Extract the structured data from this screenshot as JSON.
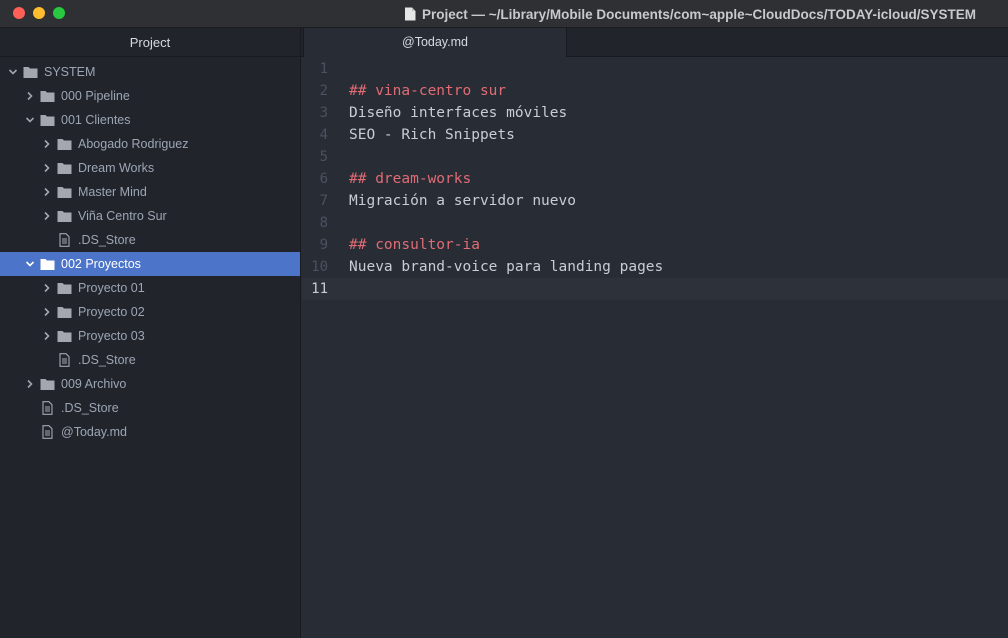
{
  "window": {
    "title": "Project — ~/Library/Mobile Documents/com~apple~CloudDocs/TODAY-icloud/SYSTEM"
  },
  "colors": {
    "selection": "#4c74c8",
    "heading": "#e06c75",
    "text": "#c8ccd4",
    "sidebar_bg": "#21252b",
    "editor_bg": "#282c34"
  },
  "sidebar": {
    "header": "Project",
    "tree": [
      {
        "label": "SYSTEM",
        "depth": 0,
        "type": "folder",
        "expanded": true,
        "selected": false
      },
      {
        "label": "000 Pipeline",
        "depth": 1,
        "type": "folder",
        "expanded": false,
        "selected": false
      },
      {
        "label": "001 Clientes",
        "depth": 1,
        "type": "folder",
        "expanded": true,
        "selected": false
      },
      {
        "label": "Abogado Rodriguez",
        "depth": 2,
        "type": "folder",
        "expanded": false,
        "selected": false
      },
      {
        "label": "Dream Works",
        "depth": 2,
        "type": "folder",
        "expanded": false,
        "selected": false
      },
      {
        "label": "Master Mind",
        "depth": 2,
        "type": "folder",
        "expanded": false,
        "selected": false
      },
      {
        "label": "Viña Centro Sur",
        "depth": 2,
        "type": "folder",
        "expanded": false,
        "selected": false
      },
      {
        "label": ".DS_Store",
        "depth": 2,
        "type": "file",
        "selected": false
      },
      {
        "label": "002 Proyectos",
        "depth": 1,
        "type": "folder",
        "expanded": true,
        "selected": true
      },
      {
        "label": "Proyecto 01",
        "depth": 2,
        "type": "folder",
        "expanded": false,
        "selected": false
      },
      {
        "label": "Proyecto 02",
        "depth": 2,
        "type": "folder",
        "expanded": false,
        "selected": false
      },
      {
        "label": "Proyecto 03",
        "depth": 2,
        "type": "folder",
        "expanded": false,
        "selected": false
      },
      {
        "label": ".DS_Store",
        "depth": 2,
        "type": "file",
        "selected": false
      },
      {
        "label": "009 Archivo",
        "depth": 1,
        "type": "folder",
        "expanded": false,
        "selected": false
      },
      {
        "label": ".DS_Store",
        "depth": 1,
        "type": "file",
        "selected": false
      },
      {
        "label": "@Today.md",
        "depth": 1,
        "type": "file",
        "selected": false
      }
    ]
  },
  "editor": {
    "tab_label": "@Today.md",
    "cursor_line": 11,
    "lines": [
      {
        "num": "1",
        "text": "",
        "style": "plain"
      },
      {
        "num": "2",
        "text": "## vina-centro sur",
        "style": "heading"
      },
      {
        "num": "3",
        "text": "Diseño interfaces móviles",
        "style": "plain"
      },
      {
        "num": "4",
        "text": "SEO - Rich Snippets",
        "style": "plain"
      },
      {
        "num": "5",
        "text": "",
        "style": "plain"
      },
      {
        "num": "6",
        "text": "## dream-works",
        "style": "heading"
      },
      {
        "num": "7",
        "text": "Migración a servidor nuevo",
        "style": "plain"
      },
      {
        "num": "8",
        "text": "",
        "style": "plain"
      },
      {
        "num": "9",
        "text": "## consultor-ia",
        "style": "heading"
      },
      {
        "num": "10",
        "text": "Nueva brand-voice para landing pages",
        "style": "plain"
      },
      {
        "num": "11",
        "text": "",
        "style": "plain"
      }
    ]
  }
}
